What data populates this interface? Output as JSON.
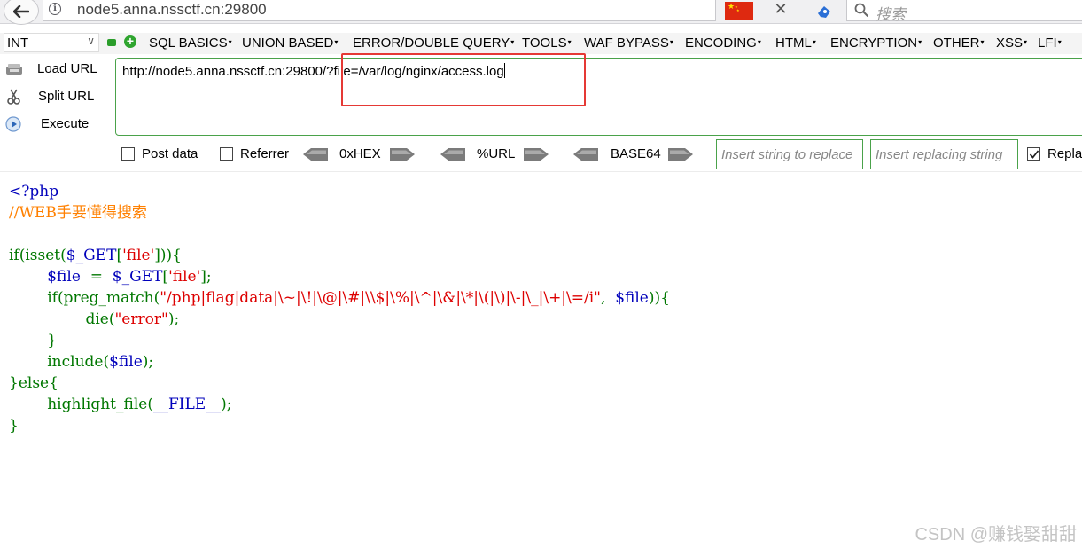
{
  "browser": {
    "url": "node5.anna.nssctf.cn:29800",
    "search_placeholder": "搜索",
    "flag": {
      "name": "china-flag-icon",
      "color": "#de2910"
    }
  },
  "hackbar": {
    "type_select": "INT",
    "menu": [
      "SQL BASICS",
      "UNION BASED",
      "ERROR/DOUBLE QUERY",
      "TOOLS",
      "WAF BYPASS",
      "ENCODING",
      "HTML",
      "ENCRYPTION",
      "OTHER",
      "XSS",
      "LFI"
    ],
    "actions": {
      "load_url": "Load URL",
      "split_url": "Split URL",
      "execute": "Execute"
    },
    "url_value": "http://node5.anna.nssctf.cn:29800/?file=/var/log/nginx/access.log",
    "options": {
      "post_data": "Post data",
      "referrer": "Referrer",
      "hex": "0xHEX",
      "url": "%URL",
      "base64": "BASE64",
      "replace_from_placeholder": "Insert string to replace",
      "replace_to_placeholder": "Insert replacing string",
      "replace_all": "Replace All",
      "replace_all_checked": true
    },
    "accent_color": "#4aa24a",
    "highlight_color": "#e53935"
  },
  "source": {
    "lines": [
      [
        {
          "t": "<?php",
          "c": "kw"
        }
      ],
      [
        {
          "t": "//WEB手要懂得搜索",
          "c": "cm"
        }
      ],
      [
        {
          "t": "",
          "c": "kw"
        }
      ],
      [
        {
          "t": "if(isset(",
          "c": "op"
        },
        {
          "t": "$_GET",
          "c": "kw"
        },
        {
          "t": "[",
          "c": "op"
        },
        {
          "t": "'file'",
          "c": "st"
        },
        {
          "t": "])){",
          "c": "op"
        }
      ],
      [
        {
          "t": "        $file  ",
          "c": "kw"
        },
        {
          "t": "= ",
          "c": "op"
        },
        {
          "t": " $_GET",
          "c": "kw"
        },
        {
          "t": "[",
          "c": "op"
        },
        {
          "t": "'file'",
          "c": "st"
        },
        {
          "t": "];",
          "c": "op"
        }
      ],
      [
        {
          "t": "        if(preg_match(",
          "c": "op"
        },
        {
          "t": "\"/php|flag|data|\\~|\\!|\\@|\\#|\\\\$|\\%|\\^|\\&|\\*|\\(|\\)|\\-|\\_|\\+|\\=/i\"",
          "c": "st"
        },
        {
          "t": ",  ",
          "c": "op"
        },
        {
          "t": "$file",
          "c": "kw"
        },
        {
          "t": ")){",
          "c": "op"
        }
      ],
      [
        {
          "t": "                die(",
          "c": "op"
        },
        {
          "t": "\"error\"",
          "c": "st"
        },
        {
          "t": ");",
          "c": "op"
        }
      ],
      [
        {
          "t": "        }",
          "c": "op"
        }
      ],
      [
        {
          "t": "        include(",
          "c": "op"
        },
        {
          "t": "$file",
          "c": "kw"
        },
        {
          "t": ");",
          "c": "op"
        }
      ],
      [
        {
          "t": "}else{",
          "c": "op"
        }
      ],
      [
        {
          "t": "        highlight_file(",
          "c": "op"
        },
        {
          "t": "__FILE__",
          "c": "kw"
        },
        {
          "t": ");",
          "c": "op"
        }
      ],
      [
        {
          "t": "}",
          "c": "op"
        }
      ]
    ]
  },
  "watermark": "CSDN @赚钱娶甜甜"
}
